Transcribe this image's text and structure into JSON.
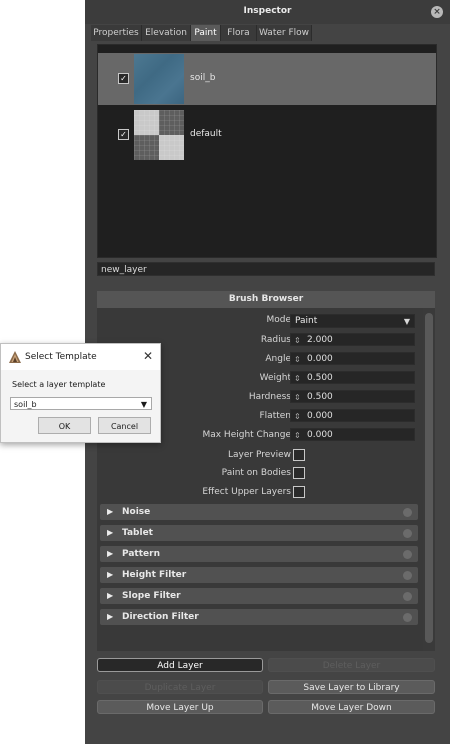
{
  "inspector": {
    "title": "Inspector",
    "close_icon": "close-icon",
    "tabs": [
      {
        "label": "Properties",
        "active": false
      },
      {
        "label": "Elevation",
        "active": false
      },
      {
        "label": "Paint",
        "active": true
      },
      {
        "label": "Flora",
        "active": false
      },
      {
        "label": "Water Flow",
        "active": false
      }
    ],
    "layers": [
      {
        "name": "soil_b",
        "checked": true,
        "selected": true,
        "checkmark": "✓"
      },
      {
        "name": "default",
        "checked": true,
        "selected": false,
        "checkmark": "✓"
      }
    ],
    "layer_name_value": "new_layer"
  },
  "brush_browser": {
    "title": "Brush Browser",
    "mode": {
      "label": "Mode",
      "value": "Paint"
    },
    "numeric_fields": [
      {
        "label": "Radius",
        "value": "2.000"
      },
      {
        "label": "Angle",
        "value": "0.000"
      },
      {
        "label": "Weight",
        "value": "0.500"
      },
      {
        "label": "Hardness",
        "value": "0.500"
      },
      {
        "label": "Flatten",
        "value": "0.000"
      },
      {
        "label": "Max Height Change",
        "value": "0.000"
      }
    ],
    "checkboxes": [
      {
        "label": "Layer Preview",
        "checked": false
      },
      {
        "label": "Paint on Bodies",
        "checked": false
      },
      {
        "label": "Effect Upper Layers",
        "checked": false
      }
    ],
    "sections": [
      "Noise",
      "Tablet",
      "Pattern",
      "Height Filter",
      "Slope Filter",
      "Direction Filter"
    ]
  },
  "actions": {
    "add_layer": "Add Layer",
    "delete_layer": "Delete Layer",
    "duplicate_layer": "Duplicate Layer",
    "save_layer": "Save Layer to Library",
    "move_up": "Move Layer Up",
    "move_down": "Move Layer Down"
  },
  "dialog": {
    "title": "Select Template",
    "prompt": "Select a layer template",
    "selected_template": "soil_b",
    "ok_label": "OK",
    "cancel_label": "Cancel"
  },
  "colors": {
    "panel_bg": "#444444",
    "active_tab": "#5a5a5a",
    "selected_layer": "#686868",
    "section_bar": "#515151"
  }
}
